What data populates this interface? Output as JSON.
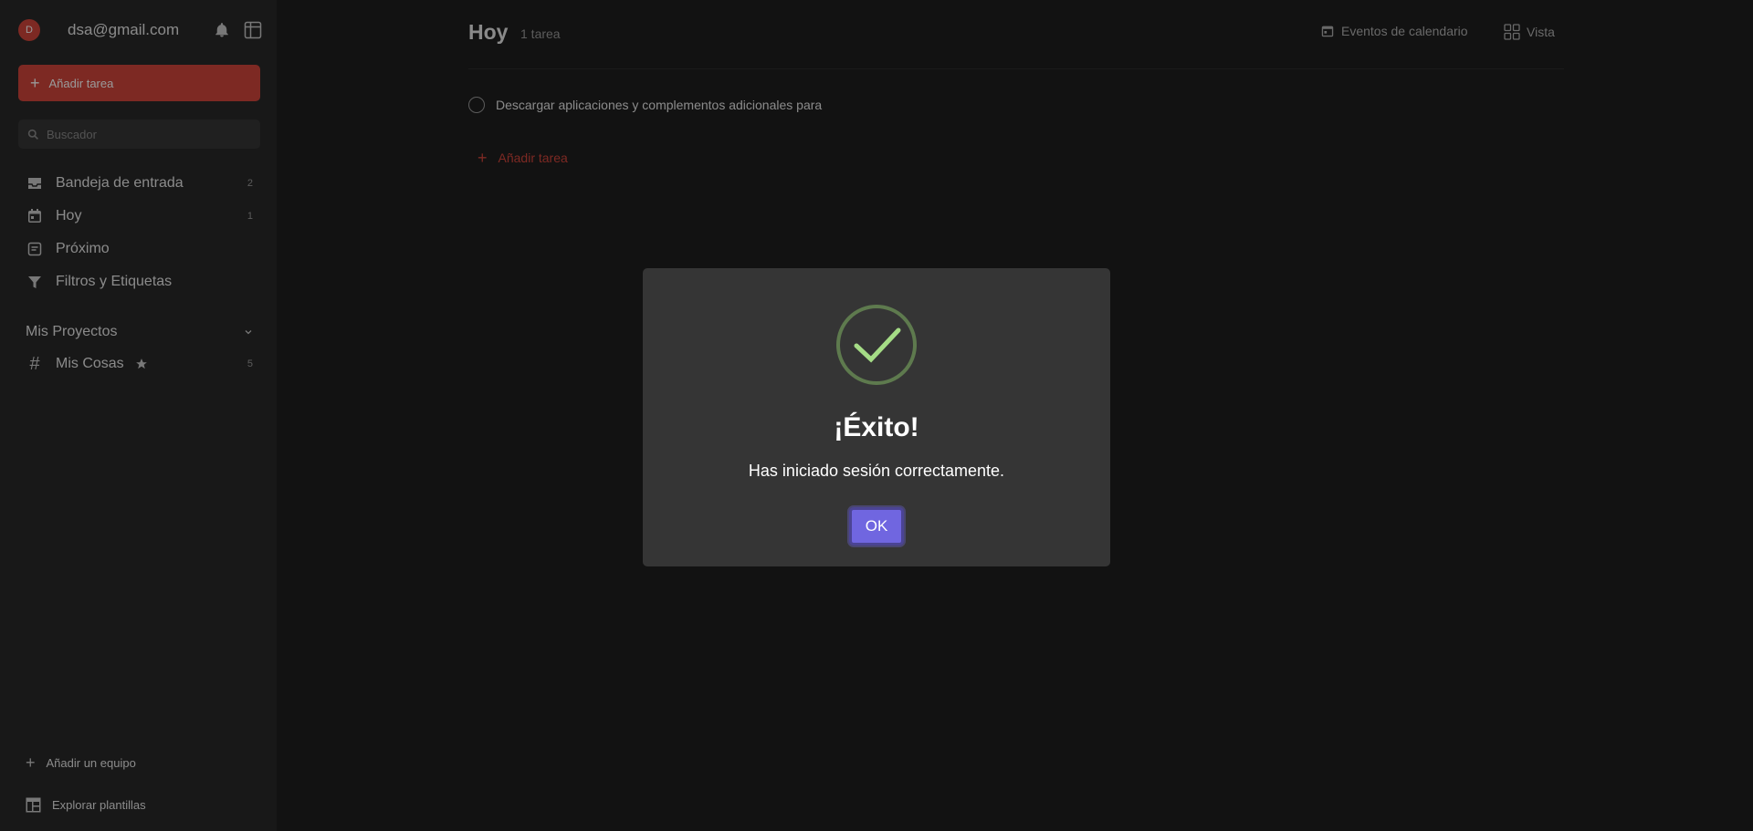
{
  "user": {
    "avatar_initial": "D",
    "email": "dsa@gmail.com"
  },
  "sidebar": {
    "add_task_label": "Añadir tarea",
    "search_placeholder": "Buscador",
    "nav": [
      {
        "label": "Bandeja de entrada",
        "count": "2",
        "icon": "inbox-icon"
      },
      {
        "label": "Hoy",
        "count": "1",
        "icon": "calendar-today-icon"
      },
      {
        "label": "Próximo",
        "count": "",
        "icon": "upcoming-icon"
      },
      {
        "label": "Filtros y Etiquetas",
        "count": "",
        "icon": "filter-icon"
      }
    ],
    "projects_header": "Mis Proyectos",
    "projects": [
      {
        "label": "Mis Cosas",
        "count": "5"
      }
    ],
    "add_team_label": "Añadir un equipo",
    "templates_label": "Explorar plantillas"
  },
  "main": {
    "title": "Hoy",
    "task_count": "1 tarea",
    "calendar_events_label": "Eventos de calendario",
    "view_label": "Vista",
    "tasks": [
      {
        "title": "Descargar aplicaciones y complementos adicionales para"
      }
    ],
    "add_task_label": "Añadir tarea"
  },
  "modal": {
    "title": "¡Éxito!",
    "message": "Has iniciado sesión correctamente.",
    "ok_label": "OK"
  },
  "colors": {
    "accent": "#d1453b",
    "ok_button": "#7066e0",
    "success_check": "#a5dc86"
  }
}
